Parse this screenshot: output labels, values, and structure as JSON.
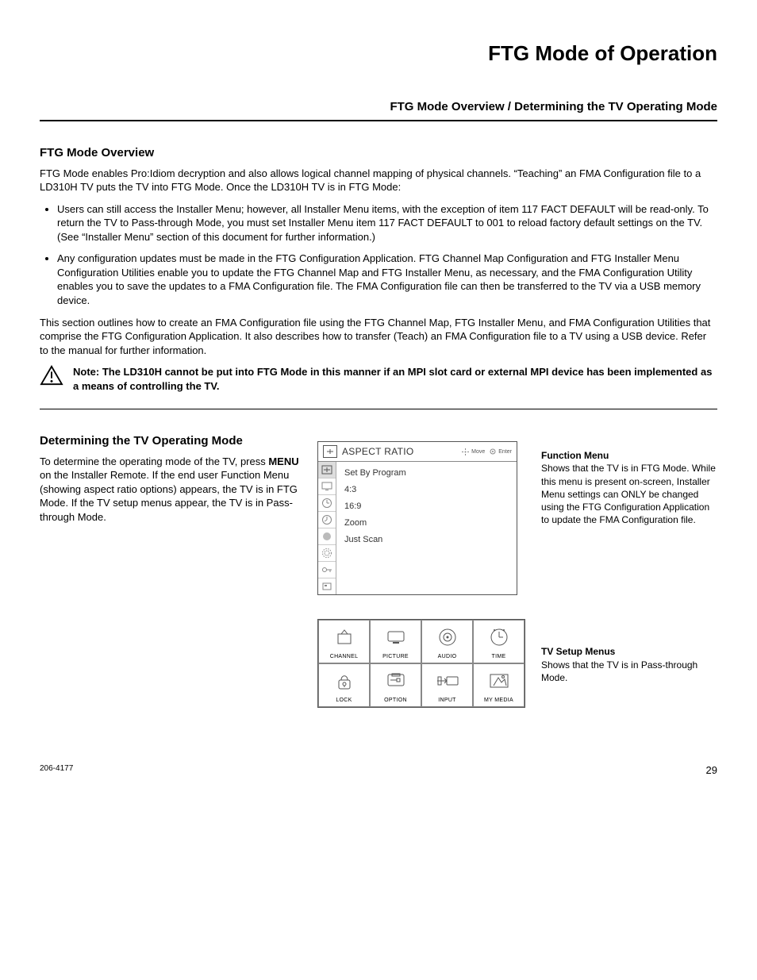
{
  "page_title": "FTG Mode of Operation",
  "subheader": "FTG Mode Overview / Determining the TV Operating Mode",
  "overview": {
    "heading": "FTG Mode Overview",
    "intro": "FTG Mode enables Pro:Idiom decryption and also allows logical channel mapping of physical channels. “Teaching” an FMA Configuration file to a LD310H TV puts the TV into FTG Mode. Once the LD310H TV is in FTG Mode:",
    "bullets": [
      "Users can still access the Installer Menu; however, all Installer Menu items, with the exception of item 117 FACT DEFAULT will be read-only. To return the TV to Pass-through Mode, you must set Installer Menu item 117 FACT DEFAULT to 001 to reload factory default settings on the TV. (See “Installer Menu” section of this document for further information.)",
      "Any conﬁguration updates must be made in the FTG Conﬁguration Application. FTG Channel Map Conﬁguration and FTG Installer Menu Conﬁguration Utilities enable you to update the FTG Channel Map and FTG Installer Menu, as necessary, and the FMA Conﬁguration Utility enables you to save the updates to a FMA Conﬁguration ﬁle. The FMA Conﬁguration ﬁle can then be transferred to the TV via a USB memory device."
    ],
    "outro": "This section outlines how to create an FMA Configuration file using the FTG Channel Map, FTG Installer Menu, and FMA Configuration Utilities that comprise the FTG Configuration Application. It also describes how to transfer (Teach) an FMA Configuration file to a TV using a USB device. Refer to the manual for further information.",
    "note": "Note: The LD310H cannot be put into FTG Mode in this manner if an MPI slot card or external MPI device has been implemented as a means of controlling the TV."
  },
  "determining": {
    "heading": "Determining the TV Operating Mode",
    "text_pre": "To determine the operating mode of the TV, press ",
    "menu_word": "MENU",
    "text_post": " on the Installer Remote. If the end user Function Menu (showing aspect ratio options) appears, the TV is in FTG Mode. If the TV setup menus appear, the TV is in Pass-through Mode."
  },
  "function_menu": {
    "title": "ASPECT RATIO",
    "hint_move": "Move",
    "hint_enter": "Enter",
    "items": [
      "Set By Program",
      "4:3",
      "16:9",
      "Zoom",
      "Just Scan"
    ],
    "caption_title": "Function Menu",
    "caption_text": "Shows that the TV is in FTG Mode. While this menu is present on-screen, Installer Menu settings can ONLY be changed using the FTG Configuration Application to update the FMA Configuration file."
  },
  "setup_menus": {
    "cells": [
      "CHANNEL",
      "PICTURE",
      "AUDIO",
      "TIME",
      "LOCK",
      "OPTION",
      "INPUT",
      "MY MEDIA"
    ],
    "caption_title": "TV Setup Menus",
    "caption_text": "Shows that the TV is in Pass-through Mode."
  },
  "footer": {
    "doc_id": "206-4177",
    "page": "29"
  }
}
